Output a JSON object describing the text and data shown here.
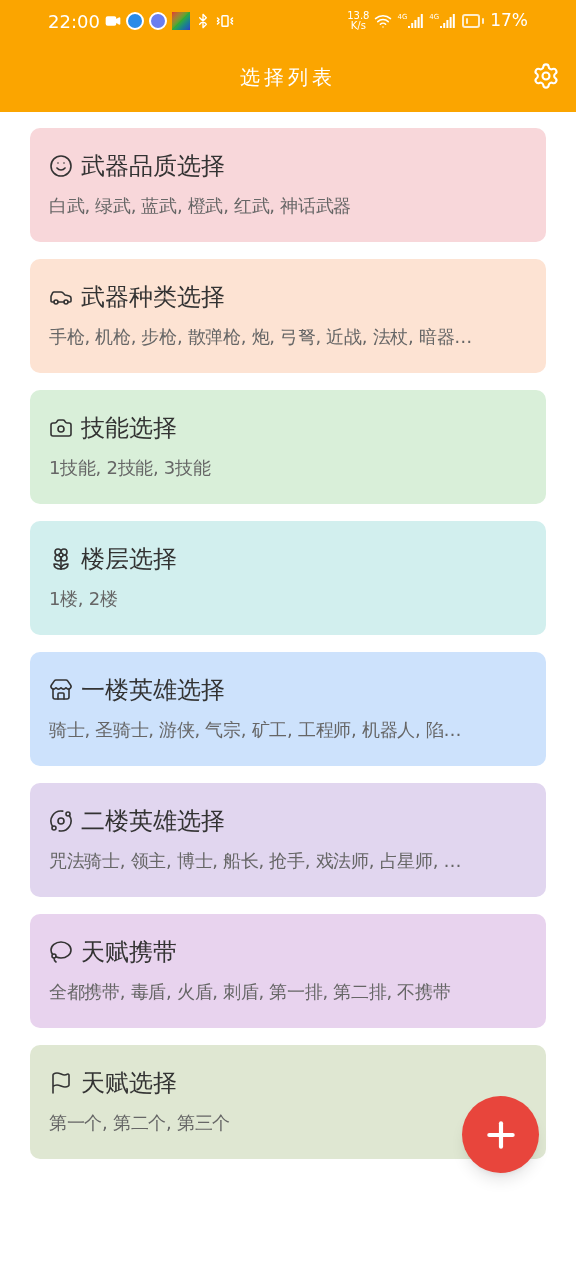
{
  "status_bar": {
    "time": "22:00",
    "speed": "13.8",
    "speed_unit": "K/s",
    "network_1": "4G",
    "network_2": "4G",
    "battery": "17%"
  },
  "app_bar": {
    "title": "选择列表"
  },
  "cards": [
    {
      "kind": "smile",
      "color": "#f8d7da",
      "title": "武器品质选择",
      "subtitle": "白武, 绿武, 蓝武, 橙武, 红武, 神话武器"
    },
    {
      "kind": "car",
      "color": "#fde3d3",
      "title": "武器种类选择",
      "subtitle": "手枪, 机枪, 步枪, 散弹枪, 炮, 弓弩, 近战, 法杖, 暗器…"
    },
    {
      "kind": "camera",
      "color": "#d9efd9",
      "title": "技能选择",
      "subtitle": "1技能, 2技能, 3技能"
    },
    {
      "kind": "flower",
      "color": "#d2efee",
      "title": "楼层选择",
      "subtitle": "1楼, 2楼"
    },
    {
      "kind": "store",
      "color": "#cde2fc",
      "title": "一楼英雄选择",
      "subtitle": "骑士, 圣骑士, 游侠, 气宗, 矿工, 工程师, 机器人, 陷…"
    },
    {
      "kind": "planet",
      "color": "#e1d6ef",
      "title": "二楼英雄选择",
      "subtitle": "咒法骑士, 领主, 博士, 船长, 抢手, 戏法师, 占星师, …"
    },
    {
      "kind": "lasso",
      "color": "#e8d3ee",
      "title": "天赋携带",
      "subtitle": "全都携带, 毒盾, 火盾, 刺盾, 第一排, 第二排, 不携带"
    },
    {
      "kind": "flag",
      "color": "#dfe7d2",
      "title": "天赋选择",
      "subtitle": "第一个, 第二个, 第三个"
    }
  ]
}
